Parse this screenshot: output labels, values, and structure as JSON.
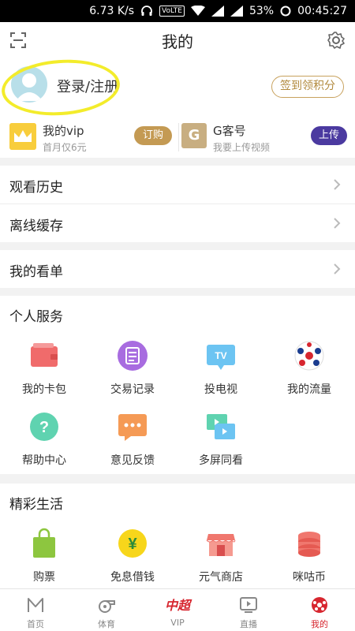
{
  "status_bar": {
    "speed": "6.73 K/s",
    "volte": "VoLTE",
    "battery": "53%",
    "time": "00:45:27"
  },
  "header": {
    "title": "我的"
  },
  "profile": {
    "login_label": "登录/注册",
    "signin_label": "签到领积分"
  },
  "vip": {
    "name": "我的vip",
    "sub": "首月仅6元",
    "button": "订购"
  },
  "g_account": {
    "logo": "G",
    "name": "G客号",
    "sub": "我要上传视频",
    "button": "上传"
  },
  "list": {
    "history": "观看历史",
    "offline": "离线缓存",
    "watchlist": "我的看单"
  },
  "personal_services": {
    "title": "个人服务",
    "items": [
      {
        "label": "我的卡包",
        "icon": "wallet-icon"
      },
      {
        "label": "交易记录",
        "icon": "receipt-icon"
      },
      {
        "label": "投电视",
        "icon": "tv-cast-icon"
      },
      {
        "label": "我的流量",
        "icon": "soccer-ball-icon"
      },
      {
        "label": "帮助中心",
        "icon": "help-icon"
      },
      {
        "label": "意见反馈",
        "icon": "feedback-icon"
      },
      {
        "label": "多屏同看",
        "icon": "multi-screen-icon"
      }
    ]
  },
  "life": {
    "title": "精彩生活",
    "items": [
      {
        "label": "购票",
        "icon": "shopping-bag-icon"
      },
      {
        "label": "免息借钱",
        "icon": "yuan-coin-icon"
      },
      {
        "label": "元气商店",
        "icon": "store-icon"
      },
      {
        "label": "咪咕币",
        "icon": "coin-stack-icon"
      }
    ]
  },
  "bottom_nav": [
    {
      "label": "首页",
      "icon": "home-icon"
    },
    {
      "label": "体育",
      "icon": "whistle-icon"
    },
    {
      "label": "VIP",
      "icon": "chinese-super-league-icon",
      "glyph": "中超"
    },
    {
      "label": "直播",
      "icon": "live-tv-icon"
    },
    {
      "label": "我的",
      "icon": "profile-ball-icon"
    }
  ],
  "colors": {
    "accent": "#d7262f",
    "gold": "#c49a53",
    "purple": "#4b3aa0",
    "highlight": "#f3ec2b"
  }
}
